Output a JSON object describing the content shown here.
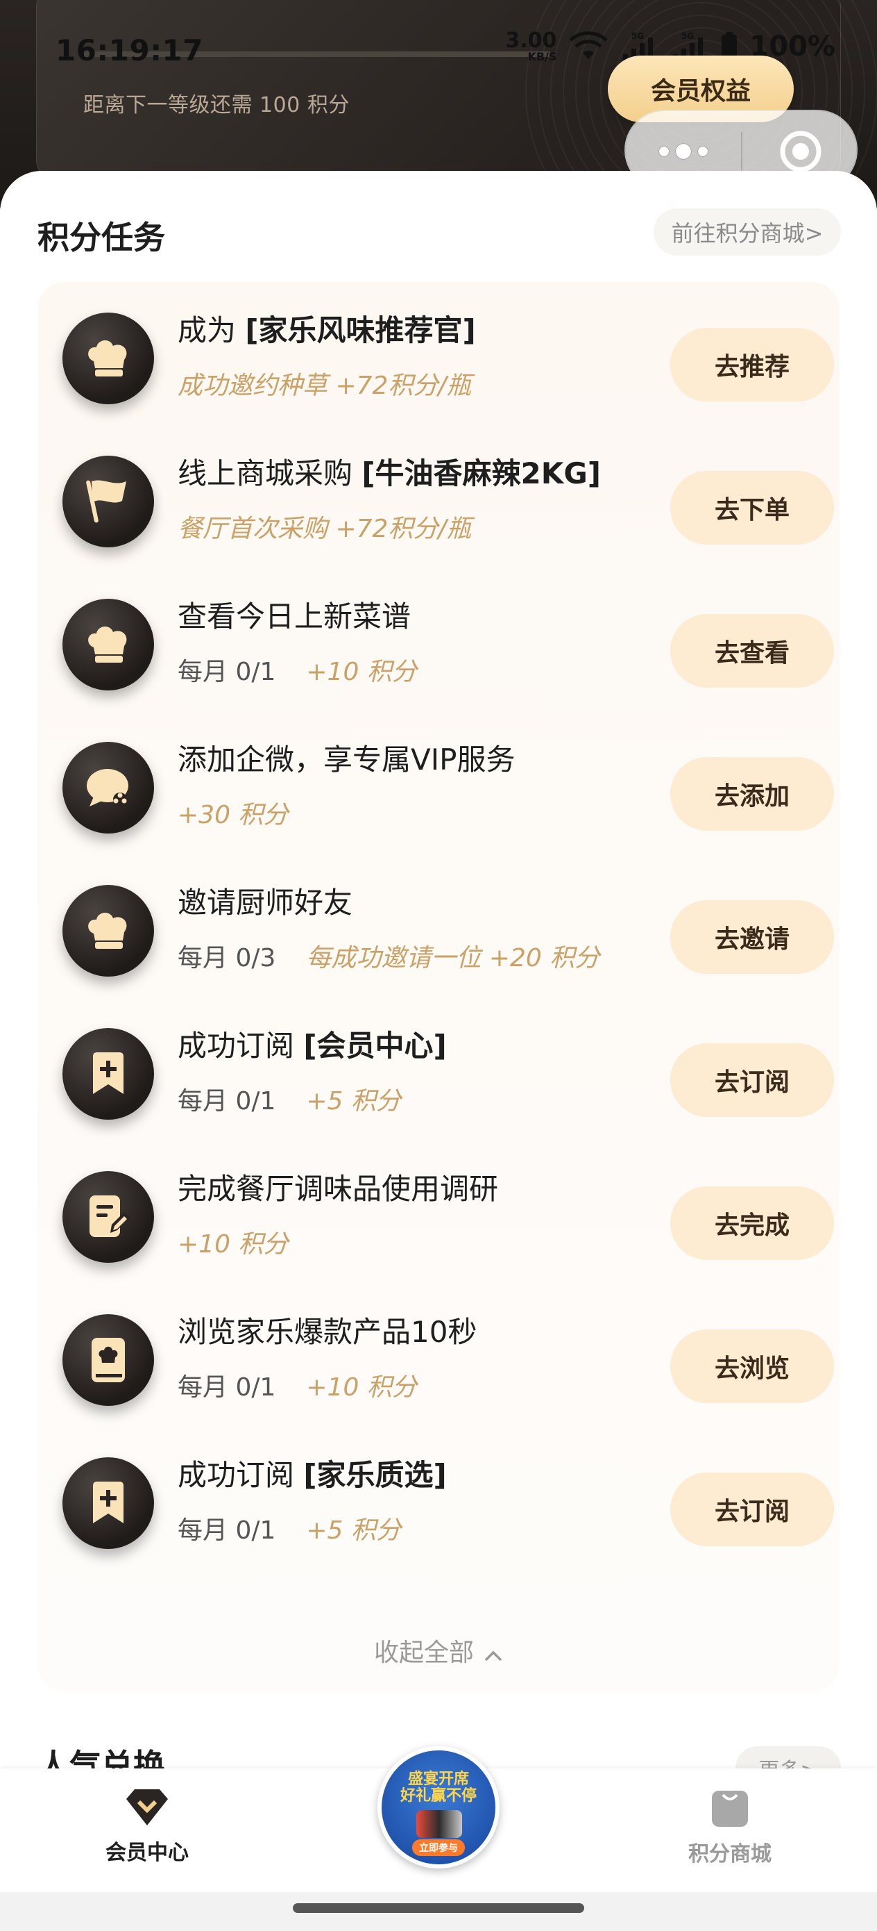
{
  "status_bar": {
    "time": "16:19:17",
    "net_speed_value": "3.00",
    "net_speed_unit": "KB/S",
    "signal1_label": "5G",
    "signal2_label": "5G",
    "battery": "100%"
  },
  "header": {
    "level_hint": "距离下一等级还需 100 积分",
    "member_benefit_label": "会员权益"
  },
  "tasks_section": {
    "title": "积分任务",
    "mall_link": "前往积分商城>",
    "collapse_label": "收起全部",
    "items": [
      {
        "title_prefix": "成为 ",
        "title_bold": "[家乐风味推荐官]",
        "count": "",
        "reward": "成功邀约种草 +72积分/瓶",
        "button": "去推荐",
        "icon": "chef-hat-icon"
      },
      {
        "title_prefix": "线上商城采购 ",
        "title_bold": "[牛油香麻辣2KG]",
        "count": "",
        "reward": "餐厅首次采购 +72积分/瓶",
        "button": "去下单",
        "icon": "flag-icon"
      },
      {
        "title_prefix": "查看今日上新菜谱",
        "title_bold": "",
        "count": "每月 0/1",
        "reward": "+10 积分",
        "button": "去查看",
        "icon": "chef-hat-icon"
      },
      {
        "title_prefix": "添加企微，享专属VIP服务",
        "title_bold": "",
        "count": "",
        "reward": "+30 积分",
        "button": "去添加",
        "icon": "chat-bubble-icon"
      },
      {
        "title_prefix": "邀请厨师好友",
        "title_bold": "",
        "count": "每月 0/3",
        "reward": "每成功邀请一位 +20 积分",
        "button": "去邀请",
        "icon": "chef-hat-icon"
      },
      {
        "title_prefix": "成功订阅 ",
        "title_bold": "[会员中心]",
        "count": "每月 0/1",
        "reward": "+5 积分",
        "button": "去订阅",
        "icon": "bookmark-plus-icon"
      },
      {
        "title_prefix": "完成餐厅调味品使用调研",
        "title_bold": "",
        "count": "",
        "reward": "+10 积分",
        "button": "去完成",
        "icon": "survey-edit-icon"
      },
      {
        "title_prefix": "浏览家乐爆款产品10秒",
        "title_bold": "",
        "count": "每月 0/1",
        "reward": "+10 积分",
        "button": "去浏览",
        "icon": "recipe-book-icon"
      },
      {
        "title_prefix": "成功订阅 ",
        "title_bold": "[家乐质选]",
        "count": "每月 0/1",
        "reward": "+5 积分",
        "button": "去订阅",
        "icon": "bookmark-plus-icon"
      }
    ]
  },
  "popular_section": {
    "title": "人气兑换",
    "more": "更多>"
  },
  "tabbar": {
    "left_label": "会员中心",
    "right_label": "积分商城",
    "promo_line1": "盛宴开席",
    "promo_line2": "好礼赢不停",
    "promo_button": "立即参与"
  },
  "colors": {
    "accent_gold": "#caa167",
    "button_bg": "#fdebd2",
    "dark_header": "#1c1917"
  }
}
